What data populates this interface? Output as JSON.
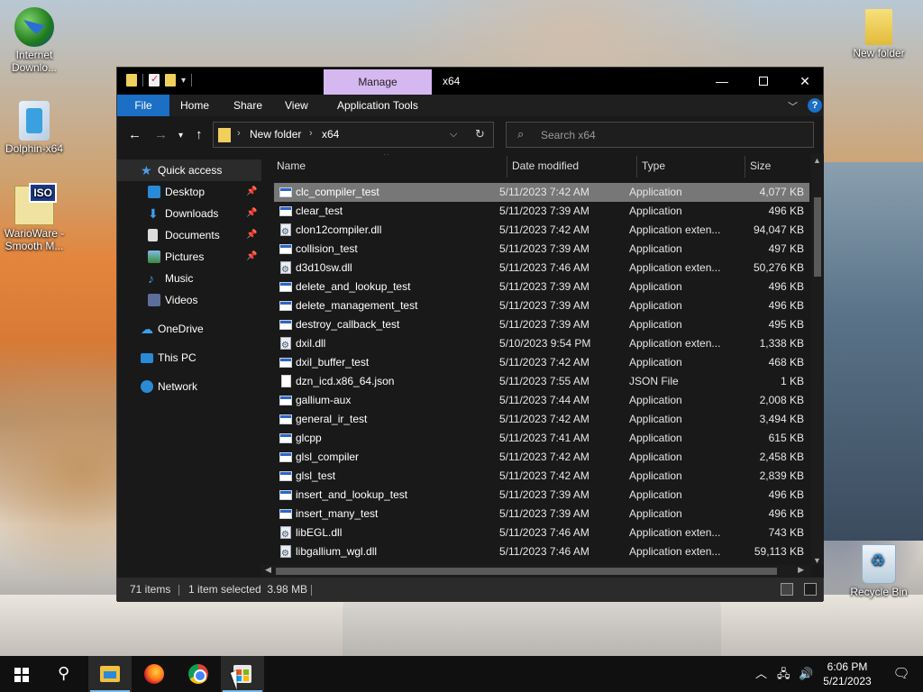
{
  "desktop": {
    "icons": [
      {
        "label": "Internet Downlo...",
        "icon": "idm-icon"
      },
      {
        "label": "Dolphin-x64",
        "icon": "dolphin-icon"
      },
      {
        "label": "WarioWare - Smooth M...",
        "icon": "iso-icon"
      },
      {
        "label": "New folder",
        "icon": "folder-icon"
      },
      {
        "label": "Recycle Bin",
        "icon": "recycle-bin-icon"
      }
    ],
    "iso_badge": "ISO"
  },
  "window": {
    "title": "x64",
    "manage_tab": "Manage",
    "ribbon_tabs": [
      "File",
      "Home",
      "Share",
      "View",
      "Application Tools"
    ],
    "accent": "#1b6fc4",
    "manage_color": "#d6b8f0",
    "breadcrumb": [
      "New folder",
      "x64"
    ],
    "search_placeholder": "Search x64",
    "help": "?"
  },
  "nav": {
    "items": [
      {
        "label": "Quick access",
        "icon": "star-icon",
        "pinned": false
      },
      {
        "label": "Desktop",
        "icon": "desktop-icon",
        "pinned": true
      },
      {
        "label": "Downloads",
        "icon": "download-icon",
        "pinned": true
      },
      {
        "label": "Documents",
        "icon": "documents-icon",
        "pinned": true
      },
      {
        "label": "Pictures",
        "icon": "pictures-icon",
        "pinned": true
      },
      {
        "label": "Music",
        "icon": "music-icon",
        "pinned": false
      },
      {
        "label": "Videos",
        "icon": "videos-icon",
        "pinned": false
      },
      {
        "label": "OneDrive",
        "icon": "cloud-icon",
        "pinned": false
      },
      {
        "label": "This PC",
        "icon": "pc-icon",
        "pinned": false
      },
      {
        "label": "Network",
        "icon": "network-icon",
        "pinned": false
      }
    ]
  },
  "columns": [
    "Name",
    "Date modified",
    "Type",
    "Size"
  ],
  "files": [
    {
      "name": "clc_compiler_test",
      "date": "5/11/2023 7:42 AM",
      "type": "Application",
      "size": "4,077 KB",
      "kind": "app",
      "selected": true
    },
    {
      "name": "clear_test",
      "date": "5/11/2023 7:39 AM",
      "type": "Application",
      "size": "496 KB",
      "kind": "app"
    },
    {
      "name": "clon12compiler.dll",
      "date": "5/11/2023 7:42 AM",
      "type": "Application exten...",
      "size": "94,047 KB",
      "kind": "dll"
    },
    {
      "name": "collision_test",
      "date": "5/11/2023 7:39 AM",
      "type": "Application",
      "size": "497 KB",
      "kind": "app"
    },
    {
      "name": "d3d10sw.dll",
      "date": "5/11/2023 7:46 AM",
      "type": "Application exten...",
      "size": "50,276 KB",
      "kind": "dll"
    },
    {
      "name": "delete_and_lookup_test",
      "date": "5/11/2023 7:39 AM",
      "type": "Application",
      "size": "496 KB",
      "kind": "app"
    },
    {
      "name": "delete_management_test",
      "date": "5/11/2023 7:39 AM",
      "type": "Application",
      "size": "496 KB",
      "kind": "app"
    },
    {
      "name": "destroy_callback_test",
      "date": "5/11/2023 7:39 AM",
      "type": "Application",
      "size": "495 KB",
      "kind": "app"
    },
    {
      "name": "dxil.dll",
      "date": "5/10/2023 9:54 PM",
      "type": "Application exten...",
      "size": "1,338 KB",
      "kind": "dll"
    },
    {
      "name": "dxil_buffer_test",
      "date": "5/11/2023 7:42 AM",
      "type": "Application",
      "size": "468 KB",
      "kind": "app"
    },
    {
      "name": "dzn_icd.x86_64.json",
      "date": "5/11/2023 7:55 AM",
      "type": "JSON File",
      "size": "1 KB",
      "kind": "json"
    },
    {
      "name": "gallium-aux",
      "date": "5/11/2023 7:44 AM",
      "type": "Application",
      "size": "2,008 KB",
      "kind": "app"
    },
    {
      "name": "general_ir_test",
      "date": "5/11/2023 7:42 AM",
      "type": "Application",
      "size": "3,494 KB",
      "kind": "app"
    },
    {
      "name": "glcpp",
      "date": "5/11/2023 7:41 AM",
      "type": "Application",
      "size": "615 KB",
      "kind": "app"
    },
    {
      "name": "glsl_compiler",
      "date": "5/11/2023 7:42 AM",
      "type": "Application",
      "size": "2,458 KB",
      "kind": "app"
    },
    {
      "name": "glsl_test",
      "date": "5/11/2023 7:42 AM",
      "type": "Application",
      "size": "2,839 KB",
      "kind": "app"
    },
    {
      "name": "insert_and_lookup_test",
      "date": "5/11/2023 7:39 AM",
      "type": "Application",
      "size": "496 KB",
      "kind": "app"
    },
    {
      "name": "insert_many_test",
      "date": "5/11/2023 7:39 AM",
      "type": "Application",
      "size": "496 KB",
      "kind": "app"
    },
    {
      "name": "libEGL.dll",
      "date": "5/11/2023 7:46 AM",
      "type": "Application exten...",
      "size": "743 KB",
      "kind": "dll"
    },
    {
      "name": "libgallium_wgl.dll",
      "date": "5/11/2023 7:46 AM",
      "type": "Application exten...",
      "size": "59,113 KB",
      "kind": "dll"
    }
  ],
  "status": {
    "count": "71 items",
    "selected": "1 item selected  3.98 MB"
  },
  "taskbar": {
    "apps": [
      "start-icon",
      "search-icon",
      "file-explorer-icon",
      "firefox-icon",
      "chrome-icon",
      "store-icon"
    ],
    "time": "6:06 PM",
    "date": "5/21/2023"
  }
}
